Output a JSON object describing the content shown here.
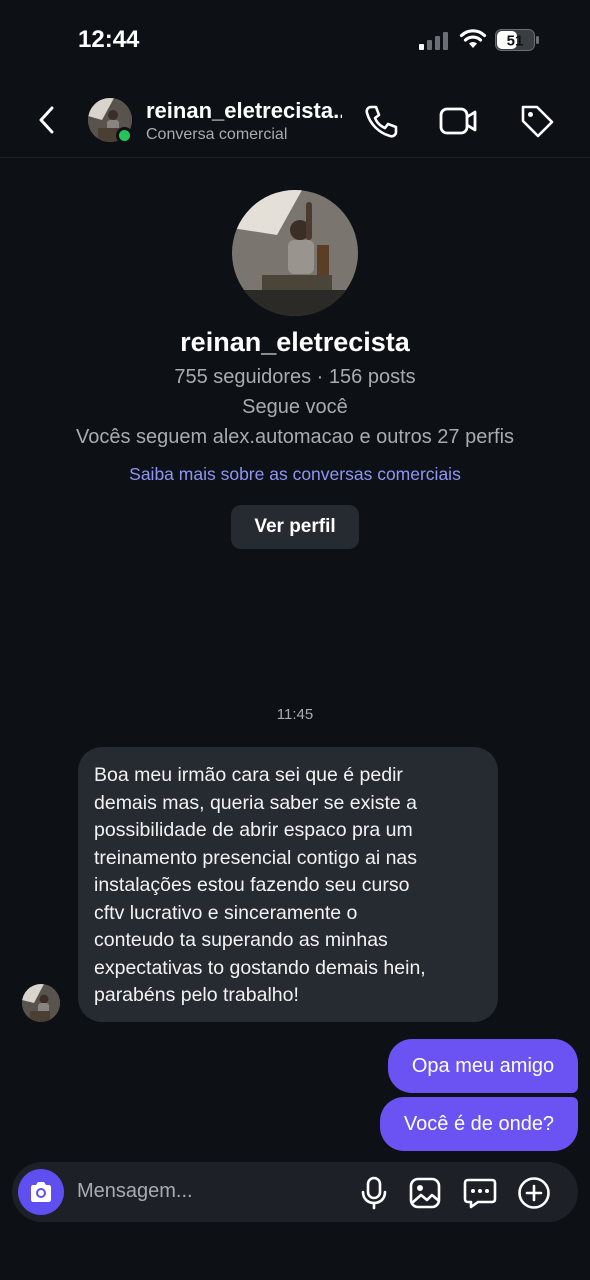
{
  "status_bar": {
    "time": "12:44",
    "battery": "51",
    "icons": [
      "signal-icon",
      "wifi-icon",
      "battery-icon"
    ]
  },
  "header": {
    "name": "reinan_eletrecista...",
    "subtitle": "Conversa comercial",
    "icons": [
      "back-icon",
      "phone-icon",
      "video-icon",
      "tag-icon"
    ],
    "online_color": "#25c35a"
  },
  "profile": {
    "username": "reinan_eletrecista",
    "stats": "755 seguidores · 156 posts",
    "follows_you": "Segue você",
    "mutual": "Vocês seguem alex.automacao e outros 27 perfis",
    "learn_more_link": "Saiba mais sobre as conversas comerciais",
    "view_profile_label": "Ver perfil"
  },
  "conversation": {
    "timestamp": "11:45",
    "messages": [
      {
        "direction": "incoming",
        "text": "Boa meu irmão  cara sei que é pedir\ndemais mas, queria saber se existe a\npossibilidade de abrir espaco pra um\ntreinamento presencial contigo ai nas\ninstalações estou fazendo seu curso\ncftv lucrativo e sinceramente o\nconteudo ta superando as minhas\nexpectativas to gostando demais hein,\nparabéns pelo trabalho!"
      },
      {
        "direction": "outgoing",
        "text": "Opa meu amigo"
      },
      {
        "direction": "outgoing",
        "text": "Você é de onde?"
      }
    ]
  },
  "composer": {
    "placeholder": "Mensagem...",
    "icons": [
      "camera-icon",
      "mic-icon",
      "gallery-icon",
      "sticker-icon",
      "plus-icon"
    ]
  },
  "colors": {
    "background": "#0d1116",
    "incoming_bubble": "#262a31",
    "outgoing_bubble": "#6a52f3",
    "link": "#8f95f5",
    "accent": "#5f4ff0"
  }
}
